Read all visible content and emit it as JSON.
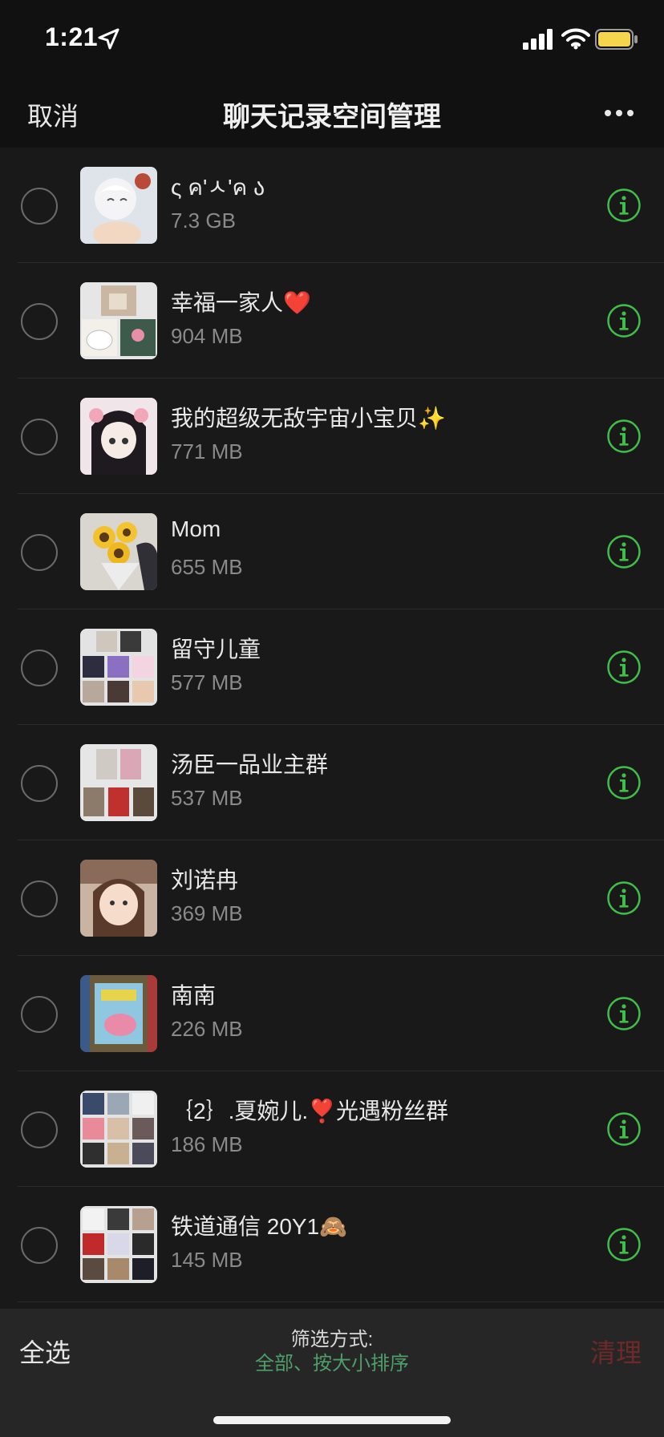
{
  "status_bar": {
    "time": "1:21",
    "battery_color": "#f3d54e"
  },
  "nav": {
    "cancel": "取消",
    "title": "聊天记录空间管理",
    "more_icon": "more-dots-icon"
  },
  "chats": [
    {
      "name": "ς ค'ㅅ'ค ა",
      "size": "7.3 GB"
    },
    {
      "name": "幸福一家人❤️",
      "size": "904 MB"
    },
    {
      "name": "我的超级无敌宇宙小宝贝✨",
      "size": "771 MB"
    },
    {
      "name": "Mom",
      "size": "655 MB"
    },
    {
      "name": "留守儿童",
      "size": "577 MB"
    },
    {
      "name": "汤臣一品业主群",
      "size": "537 MB"
    },
    {
      "name": "刘诺冉",
      "size": "369 MB"
    },
    {
      "name": "南南",
      "size": "226 MB"
    },
    {
      "name": "｛2｝.夏婉儿.❣️光遇粉丝群",
      "size": "186 MB"
    },
    {
      "name": "铁道通信 20Y1🙈",
      "size": "145 MB"
    }
  ],
  "bottom": {
    "select_all": "全选",
    "filter_label": "筛选方式:",
    "filter_value": "全部、按大小排序",
    "clean": "清理"
  },
  "colors": {
    "accent_green": "#3fbf4a",
    "filter_green": "#4e9e6a",
    "clean_disabled": "#6e2a2a"
  }
}
